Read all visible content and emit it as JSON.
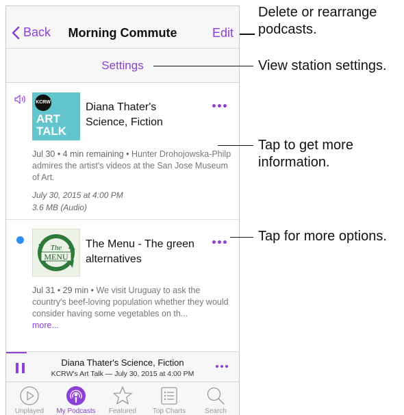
{
  "nav": {
    "back_label": "Back",
    "title": "Morning Commute",
    "edit_label": "Edit"
  },
  "settings": {
    "label": "Settings"
  },
  "episodes": [
    {
      "title": "Diana Thater's Science, Fiction",
      "description_prefix": "Jul 30 • 4 min remaining •",
      "description_text": " Hunter Drohojowska-Philp admires the artist's videos at the San Jose Museum of Art.",
      "date_line": "July 30, 2015 at 4:00 PM",
      "size_line": "3.6 MB (Audio)",
      "artwork_badge": "KCRW",
      "artwork_text_1": "ART",
      "artwork_text_2": "TALK",
      "status_icon": "speaker-playing-icon"
    },
    {
      "title": "The Menu - The green alternatives",
      "description_prefix": "Jul 31 • 29 min •",
      "description_text": " We visit Uruguay to ask the country's beef-loving population whether they would consider having some vegetables on th...",
      "more_label": "more...",
      "status_icon": "unplayed-dot-icon"
    }
  ],
  "mini_player": {
    "title": "Diana Thater's Science, Fiction",
    "subtitle": "KCRW's Art Talk — July 30, 2015 at 4:00 PM"
  },
  "tabs": [
    {
      "label": "Unplayed",
      "icon": "play-circle-icon",
      "active": false
    },
    {
      "label": "My Podcasts",
      "icon": "podcast-icon",
      "active": true
    },
    {
      "label": "Featured",
      "icon": "star-icon",
      "active": false
    },
    {
      "label": "Top Charts",
      "icon": "list-icon",
      "active": false
    },
    {
      "label": "Search",
      "icon": "search-icon",
      "active": false
    }
  ],
  "callouts": {
    "edit": "Delete or rearrange podcasts.",
    "settings": "View station settings.",
    "info": "Tap to get more information.",
    "options": "Tap for more options."
  },
  "colors": {
    "accent": "#8e3fd8",
    "unplayed": "#2f8ef5"
  }
}
